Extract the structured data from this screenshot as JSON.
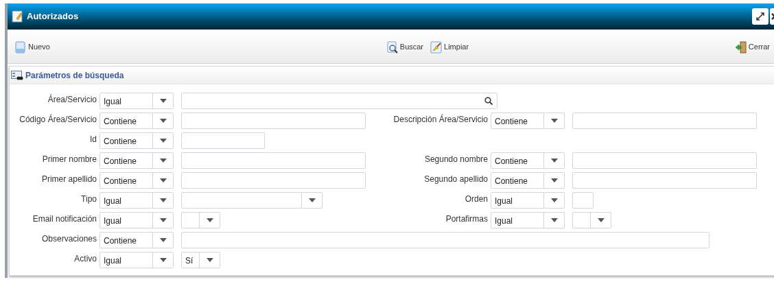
{
  "window": {
    "title": "Autorizados"
  },
  "toolbar": {
    "left": [
      {
        "label": "Nuevo",
        "kind": "new"
      }
    ],
    "center": [
      {
        "label": "Buscar",
        "kind": "search"
      },
      {
        "label": "Limpiar",
        "kind": "clear"
      }
    ],
    "right": [
      {
        "label": "Cerrar",
        "kind": "close"
      }
    ]
  },
  "section": {
    "title": "Parámetros de búsqueda"
  },
  "rows": [
    {
      "left": {
        "label": "Área/Servicio",
        "operator": "Igual",
        "value": {
          "kind": "search"
        }
      }
    },
    {
      "left": {
        "label": "Código Área/Servicio",
        "operator": "Contiene",
        "value": {
          "kind": "text"
        }
      },
      "right": {
        "label": "Descripción Área/Servicio",
        "operator": "Contiene",
        "value": {
          "kind": "text"
        }
      }
    },
    {
      "left": {
        "label": "Id",
        "operator": "Contiene",
        "value": {
          "kind": "short"
        }
      }
    },
    {
      "left": {
        "label": "Primer nombre",
        "operator": "Contiene",
        "value": {
          "kind": "text"
        }
      },
      "right": {
        "label": "Segundo nombre",
        "operator": "Contiene",
        "value": {
          "kind": "text"
        }
      }
    },
    {
      "left": {
        "label": "Primer apellido",
        "operator": "Contiene",
        "value": {
          "kind": "text"
        }
      },
      "right": {
        "label": "Segundo apellido",
        "operator": "Contiene",
        "value": {
          "kind": "text"
        }
      }
    },
    {
      "left": {
        "label": "Tipo",
        "operator": "Igual",
        "value": {
          "kind": "combo"
        }
      },
      "right": {
        "label": "Orden",
        "operator": "Igual",
        "value": {
          "kind": "tiny"
        }
      }
    },
    {
      "left": {
        "label": "Email notificación",
        "operator": "Igual",
        "value": {
          "kind": "toggle"
        }
      },
      "right": {
        "label": "Portafirmas",
        "operator": "Igual",
        "value": {
          "kind": "toggle"
        }
      }
    },
    {
      "left": {
        "label": "Observaciones",
        "operator": "Contiene",
        "value": {
          "kind": "long"
        }
      }
    },
    {
      "left": {
        "label": "Activo",
        "operator": "Igual",
        "value": {
          "kind": "toggle",
          "text": "Sí"
        }
      }
    }
  ]
}
